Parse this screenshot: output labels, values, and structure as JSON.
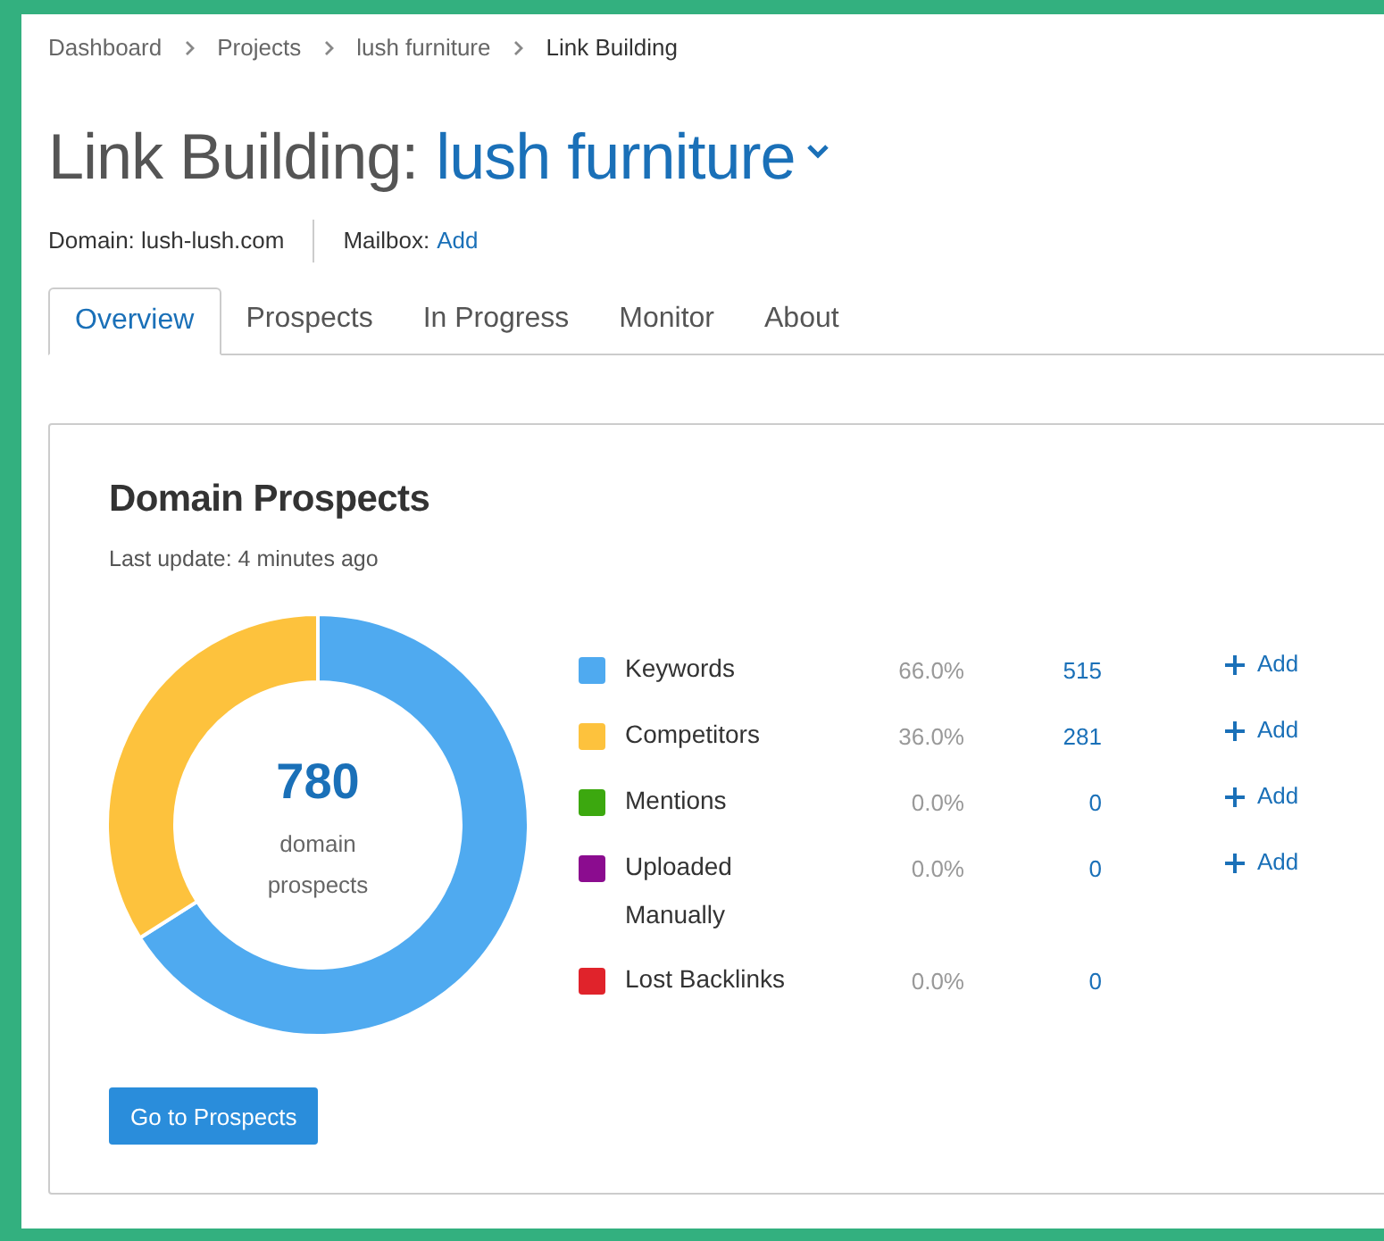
{
  "breadcrumbs": [
    {
      "label": "Dashboard",
      "current": false
    },
    {
      "label": "Projects",
      "current": false
    },
    {
      "label": "lush furniture",
      "current": false
    },
    {
      "label": "Link Building",
      "current": true
    }
  ],
  "title": {
    "prefix": "Link Building:",
    "project": "lush furniture"
  },
  "meta": {
    "domain": "Domain: lush-lush.com",
    "mailbox_label": "Mailbox:",
    "mailbox_link": "Add"
  },
  "tabs": [
    {
      "label": "Overview",
      "selected": true
    },
    {
      "label": "Prospects",
      "selected": false
    },
    {
      "label": "In Progress",
      "selected": false
    },
    {
      "label": "Monitor",
      "selected": false
    },
    {
      "label": "About",
      "selected": false
    }
  ],
  "card": {
    "title": "Domain Prospects",
    "subtitle": "Last update: 4 minutes ago",
    "total": "780",
    "total_label": "domain prospects",
    "chart_data": {
      "type": "donut",
      "categories": [
        "Keywords",
        "Competitors",
        "Mentions",
        "Uploaded Manually",
        "Lost Backlinks"
      ],
      "values": [
        66,
        34,
        0,
        0,
        0
      ]
    },
    "legend": [
      {
        "color": "#4faaf0",
        "percent": "66.0%",
        "count": "515",
        "action": "Add"
      },
      {
        "color": "#fdc23d",
        "percent": "36.0%",
        "count": "281",
        "action": "Add"
      },
      {
        "color": "#3ca80f",
        "percent": "0.0%",
        "count": "0",
        "action": "Add"
      },
      {
        "color": "#8b0c8f",
        "percent": "0.0%",
        "count": "0",
        "action": "Add"
      },
      {
        "color": "#e0232b",
        "percent": "0.0%",
        "count": "0"
      }
    ],
    "button": "Go to Prospects"
  }
}
